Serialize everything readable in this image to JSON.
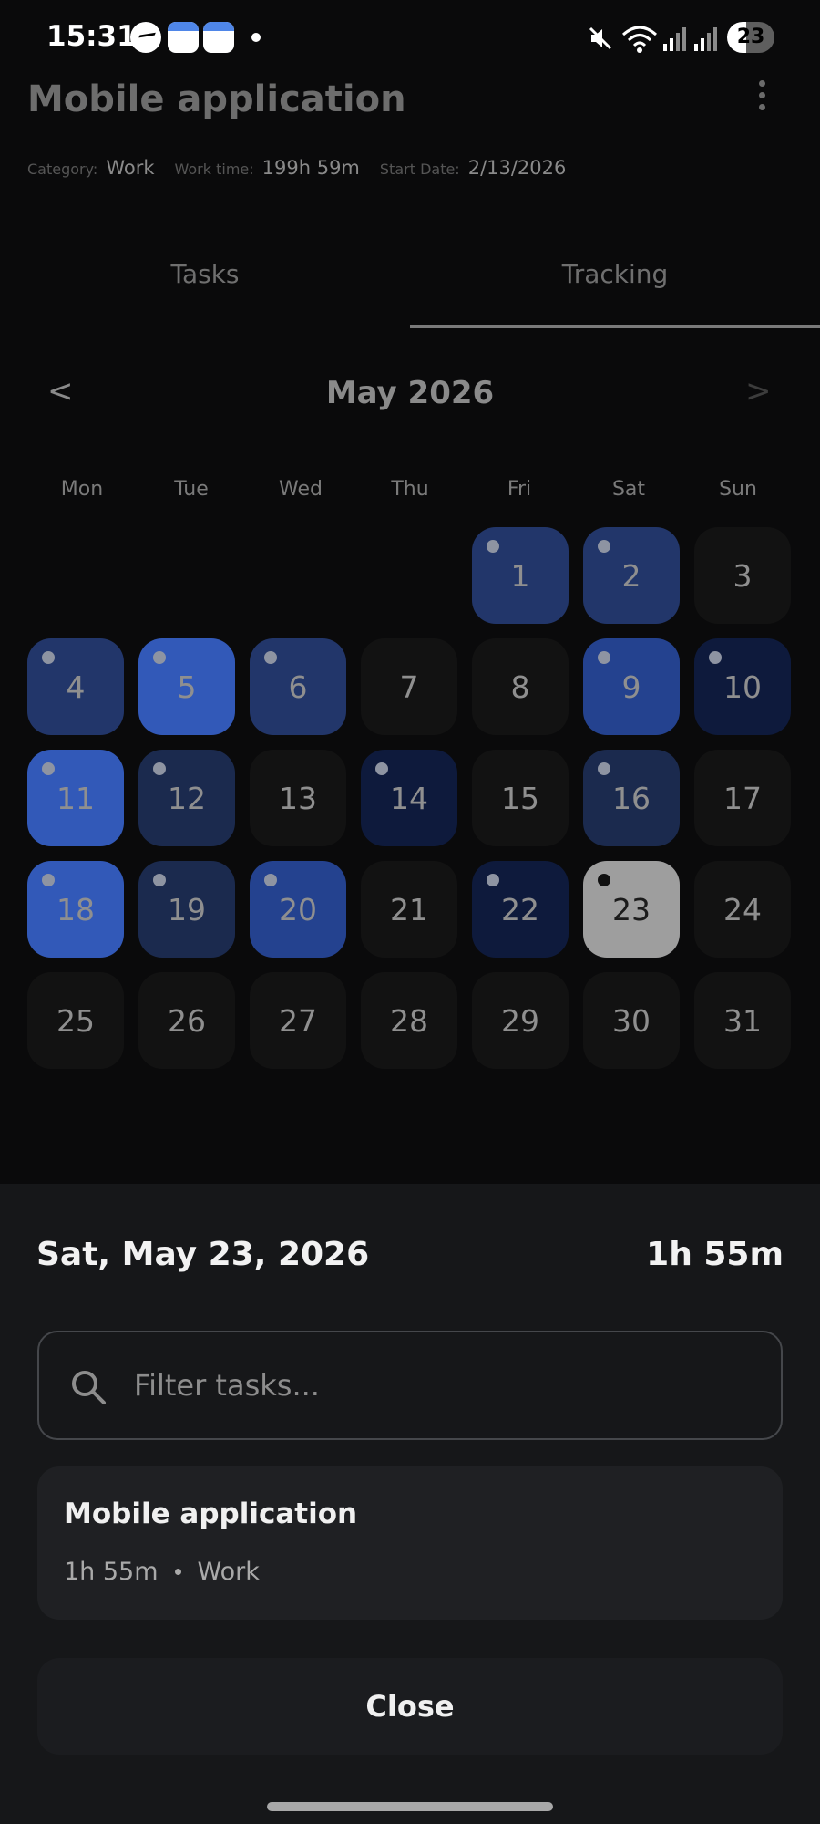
{
  "status_bar": {
    "time": "15:31",
    "battery": "23"
  },
  "header": {
    "title": "Mobile application",
    "meta": {
      "category_label": "Category:",
      "category_value": "Work",
      "worktime_label": "Work time:",
      "worktime_value": "199h 59m",
      "startdate_label": "Start Date:",
      "startdate_value": "2/13/2026"
    }
  },
  "tabs": [
    {
      "label": "Tasks",
      "active": false
    },
    {
      "label": "Tracking",
      "active": true
    }
  ],
  "calendar": {
    "prev_label": "<",
    "next_label": ">",
    "month": "May 2026",
    "weekdays": [
      "Mon",
      "Tue",
      "Wed",
      "Thu",
      "Fri",
      "Sat",
      "Sun"
    ],
    "leading_empty": 4,
    "days": [
      {
        "n": "1",
        "dot": true,
        "level": 3
      },
      {
        "n": "2",
        "dot": true,
        "level": 3
      },
      {
        "n": "3",
        "dot": false,
        "level": 0
      },
      {
        "n": "4",
        "dot": true,
        "level": 3
      },
      {
        "n": "5",
        "dot": true,
        "level": 5
      },
      {
        "n": "6",
        "dot": true,
        "level": 3
      },
      {
        "n": "7",
        "dot": false,
        "level": 0
      },
      {
        "n": "8",
        "dot": false,
        "level": 0
      },
      {
        "n": "9",
        "dot": true,
        "level": 4
      },
      {
        "n": "10",
        "dot": true,
        "level": 1
      },
      {
        "n": "11",
        "dot": true,
        "level": 5
      },
      {
        "n": "12",
        "dot": true,
        "level": 2
      },
      {
        "n": "13",
        "dot": false,
        "level": 0
      },
      {
        "n": "14",
        "dot": true,
        "level": 1
      },
      {
        "n": "15",
        "dot": false,
        "level": 0
      },
      {
        "n": "16",
        "dot": true,
        "level": 2
      },
      {
        "n": "17",
        "dot": false,
        "level": 0
      },
      {
        "n": "18",
        "dot": true,
        "level": 5
      },
      {
        "n": "19",
        "dot": true,
        "level": 2
      },
      {
        "n": "20",
        "dot": true,
        "level": 4
      },
      {
        "n": "21",
        "dot": false,
        "level": 0
      },
      {
        "n": "22",
        "dot": true,
        "level": 1
      },
      {
        "n": "23",
        "dot": true,
        "level": 0,
        "selected": true
      },
      {
        "n": "24",
        "dot": false,
        "level": 0
      },
      {
        "n": "25",
        "dot": false,
        "level": 0
      },
      {
        "n": "26",
        "dot": false,
        "level": 0
      },
      {
        "n": "27",
        "dot": false,
        "level": 0
      },
      {
        "n": "28",
        "dot": false,
        "level": 0
      },
      {
        "n": "29",
        "dot": false,
        "level": 0
      },
      {
        "n": "30",
        "dot": false,
        "level": 0
      },
      {
        "n": "31",
        "dot": false,
        "level": 0
      }
    ]
  },
  "sheet": {
    "date": "Sat, May 23, 2026",
    "total": "1h 55m",
    "filter_placeholder": "Filter tasks...",
    "tasks": [
      {
        "name": "Mobile application",
        "duration": "1h 55m",
        "category": "Work"
      }
    ],
    "close_label": "Close"
  }
}
